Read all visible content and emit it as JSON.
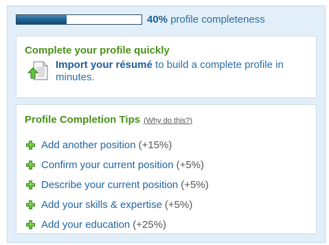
{
  "progress": {
    "percent_label": "40%",
    "text": "profile completeness",
    "fraction": 0.4
  },
  "quick": {
    "title": "Complete your profile quickly",
    "link_label": "Import your résumé",
    "rest_text": "to build a complete profile in minutes."
  },
  "tips": {
    "title": "Profile Completion Tips",
    "why_label": "(Why do this?)",
    "items": [
      {
        "label": "Add another position",
        "bonus": "(+15%)"
      },
      {
        "label": "Confirm your current position",
        "bonus": "(+5%)"
      },
      {
        "label": "Describe your current position",
        "bonus": "(+5%)"
      },
      {
        "label": "Add your skills & expertise",
        "bonus": "(+5%)"
      },
      {
        "label": "Add your education",
        "bonus": "(+25%)"
      }
    ]
  },
  "icons": {
    "import": "import-document-icon",
    "tip": "green-plus-icon"
  },
  "colors": {
    "panel_background": "#e2eef8",
    "progress_fill": "#1d5f8e",
    "heading_green": "#4a8f19",
    "link_blue": "#1f64a3"
  }
}
